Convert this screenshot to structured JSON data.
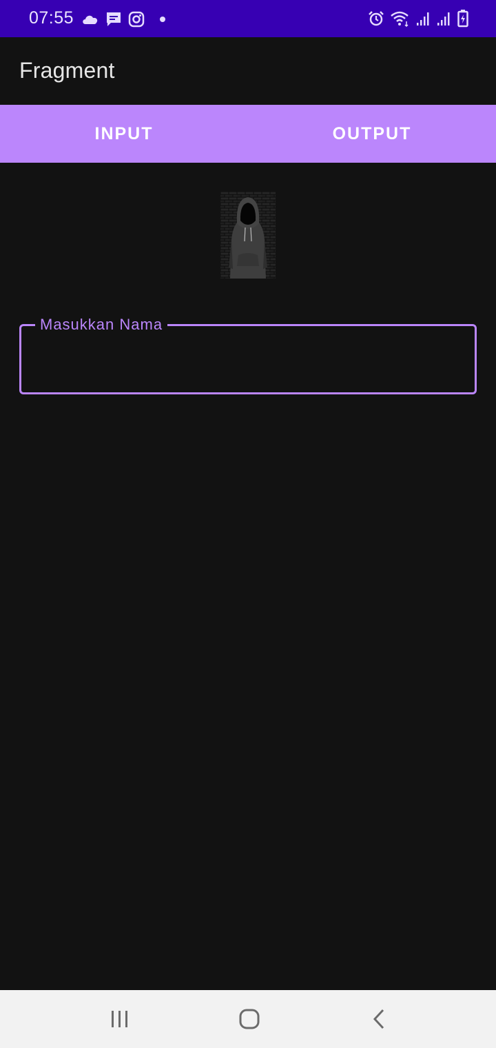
{
  "status_bar": {
    "time": "07:55",
    "background": "#3700b3",
    "left_icons": [
      "cloud-icon",
      "message-icon",
      "instagram-icon",
      "dot-icon"
    ],
    "right_icons": [
      "alarm-icon",
      "wifi-icon",
      "signal-icon",
      "signal-icon",
      "battery-charging-icon"
    ]
  },
  "app_bar": {
    "title": "Fragment"
  },
  "tabs": [
    {
      "label": "INPUT"
    },
    {
      "label": "OUTPUT"
    }
  ],
  "form": {
    "name_field": {
      "label": "Masukkan Nama",
      "value": ""
    }
  },
  "nav_bar": {
    "buttons": [
      "recent-apps-icon",
      "home-icon",
      "back-icon"
    ]
  },
  "colors": {
    "accent": "#bb86fc",
    "status_bar": "#3700b3",
    "background": "#121212",
    "nav_bar": "#f2f2f2"
  }
}
